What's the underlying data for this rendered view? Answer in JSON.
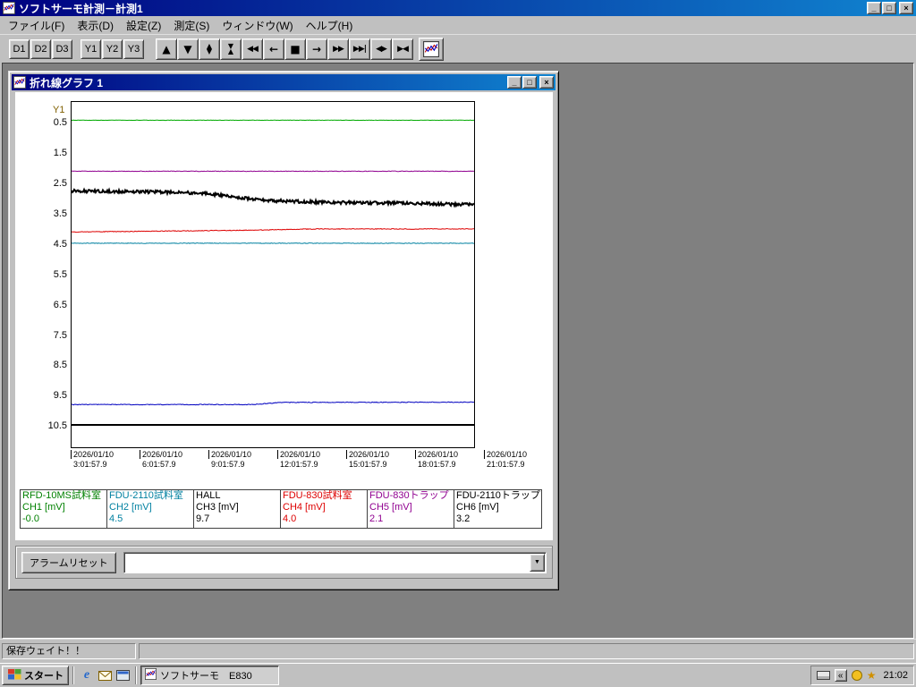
{
  "window": {
    "title": "ソフトサーモ計測－計測1"
  },
  "window_controls": {
    "minimize": "_",
    "maximize": "□",
    "close": "×"
  },
  "icons": {
    "dropdown": "▼",
    "tray_chevron": "«",
    "tray_star": "★",
    "ie": "e"
  },
  "menu": {
    "items": [
      {
        "id": "file",
        "label": "ファイル(F)"
      },
      {
        "id": "display",
        "label": "表示(D)"
      },
      {
        "id": "settings",
        "label": "設定(Z)"
      },
      {
        "id": "measure",
        "label": "測定(S)"
      },
      {
        "id": "window",
        "label": "ウィンドウ(W)"
      },
      {
        "id": "help",
        "label": "ヘルプ(H)"
      }
    ]
  },
  "toolbar": {
    "d_buttons": [
      {
        "id": "d1",
        "label": "D1"
      },
      {
        "id": "d2",
        "label": "D2"
      },
      {
        "id": "d3",
        "label": "D3"
      }
    ],
    "y_buttons": [
      {
        "id": "y1",
        "label": "Y1"
      },
      {
        "id": "y2",
        "label": "Y2"
      },
      {
        "id": "y3",
        "label": "Y3"
      }
    ],
    "nav_buttons": [
      {
        "name": "scroll-up-button",
        "glyph": "▲"
      },
      {
        "name": "scroll-down-button",
        "glyph": "▼"
      },
      {
        "name": "expand-vertical-button",
        "glyph": "▲▼",
        "stack": true
      },
      {
        "name": "compress-vertical-button",
        "glyph": "▼▲",
        "stack": true
      },
      {
        "name": "fast-rewind-button",
        "glyph": "◀◀"
      },
      {
        "name": "step-left-button",
        "glyph": "←"
      },
      {
        "name": "stop-button",
        "glyph": "■"
      },
      {
        "name": "step-right-button",
        "glyph": "→"
      },
      {
        "name": "fast-forward-button",
        "glyph": "▶▶"
      },
      {
        "name": "jump-to-end-button",
        "glyph": "▶▶|"
      },
      {
        "name": "expand-horizontal-button",
        "glyph": "◀▶"
      },
      {
        "name": "compress-horizontal-button",
        "glyph": "▶◀"
      }
    ]
  },
  "child_window": {
    "title": "折れ線グラフ 1"
  },
  "alarm": {
    "reset_label": "アラームリセット",
    "combo_value": ""
  },
  "status_bar": {
    "text": "保存ウェイト！！"
  },
  "taskbar": {
    "start_label": "スタート",
    "task_label": "ソフトサーモ　E830",
    "clock": "21:02"
  },
  "chart_data": {
    "type": "line",
    "title": "折れ線グラフ 1",
    "y_axis": {
      "label": "Y1",
      "ticks": [
        0.5,
        1.5,
        2.5,
        3.5,
        4.5,
        5.5,
        6.5,
        7.5,
        8.5,
        9.5,
        10.5
      ],
      "top_value": -0.2,
      "bottom_value": 10.4,
      "inverted": true,
      "grid": false
    },
    "x_axis": {
      "date": "2026/01/10",
      "times": [
        "3:01:57.9",
        "6:01:57.9",
        "9:01:57.9",
        "12:01:57.9",
        "15:01:57.9",
        "18:01:57.9",
        "21:01:57.9"
      ]
    },
    "series": [
      {
        "id": "ch1",
        "source": "RFD-10MS試料室",
        "ch_label": "CH1 [mV]",
        "current": "-0.0",
        "color": "#00aa00",
        "text_color": "#008000",
        "width": 1,
        "noise": 0.006,
        "points": [
          [
            0,
            0.4
          ],
          [
            1,
            0.4
          ]
        ]
      },
      {
        "id": "ch2",
        "source": "FDU-2110試料室",
        "ch_label": "CH2 [mV]",
        "current": "4.5",
        "color": "#0080a0",
        "text_color": "#0080a0",
        "width": 1,
        "noise": 0.01,
        "points": [
          [
            0,
            4.45
          ],
          [
            1,
            4.45
          ]
        ]
      },
      {
        "id": "ch3",
        "source": "HALL",
        "ch_label": "CH3 [mV]",
        "current": "9.7",
        "color": "#0000c0",
        "text_color": "#000000",
        "width": 1,
        "noise": 0.012,
        "points": [
          [
            0,
            9.76
          ],
          [
            0.45,
            9.76
          ],
          [
            0.52,
            9.69
          ],
          [
            1,
            9.68
          ]
        ]
      },
      {
        "id": "ch4",
        "source": "FDU-830試料室",
        "ch_label": "CH4 [mV]",
        "current": "4.0",
        "color": "#dd0000",
        "text_color": "#dd0000",
        "width": 1,
        "noise": 0.012,
        "points": [
          [
            0,
            4.08
          ],
          [
            0.45,
            4.02
          ],
          [
            0.6,
            3.98
          ],
          [
            1,
            3.98
          ]
        ]
      },
      {
        "id": "ch5",
        "source": "FDU-830トラップ",
        "ch_label": "CH5 [mV]",
        "current": "2.1",
        "color": "#900090",
        "text_color": "#900090",
        "width": 1,
        "noise": 0.01,
        "points": [
          [
            0,
            2.08
          ],
          [
            1,
            2.08
          ]
        ]
      },
      {
        "id": "ch6",
        "source": "FDU-2110トラップ",
        "ch_label": "CH6 [mV]",
        "current": "3.2",
        "color": "#000000",
        "text_color": "#000000",
        "width": 2,
        "noise": 0.05,
        "points": [
          [
            0,
            2.73
          ],
          [
            0.2,
            2.76
          ],
          [
            0.33,
            2.8
          ],
          [
            0.42,
            2.95
          ],
          [
            0.5,
            3.05
          ],
          [
            0.62,
            3.1
          ],
          [
            0.8,
            3.13
          ],
          [
            1,
            3.18
          ]
        ]
      }
    ]
  }
}
